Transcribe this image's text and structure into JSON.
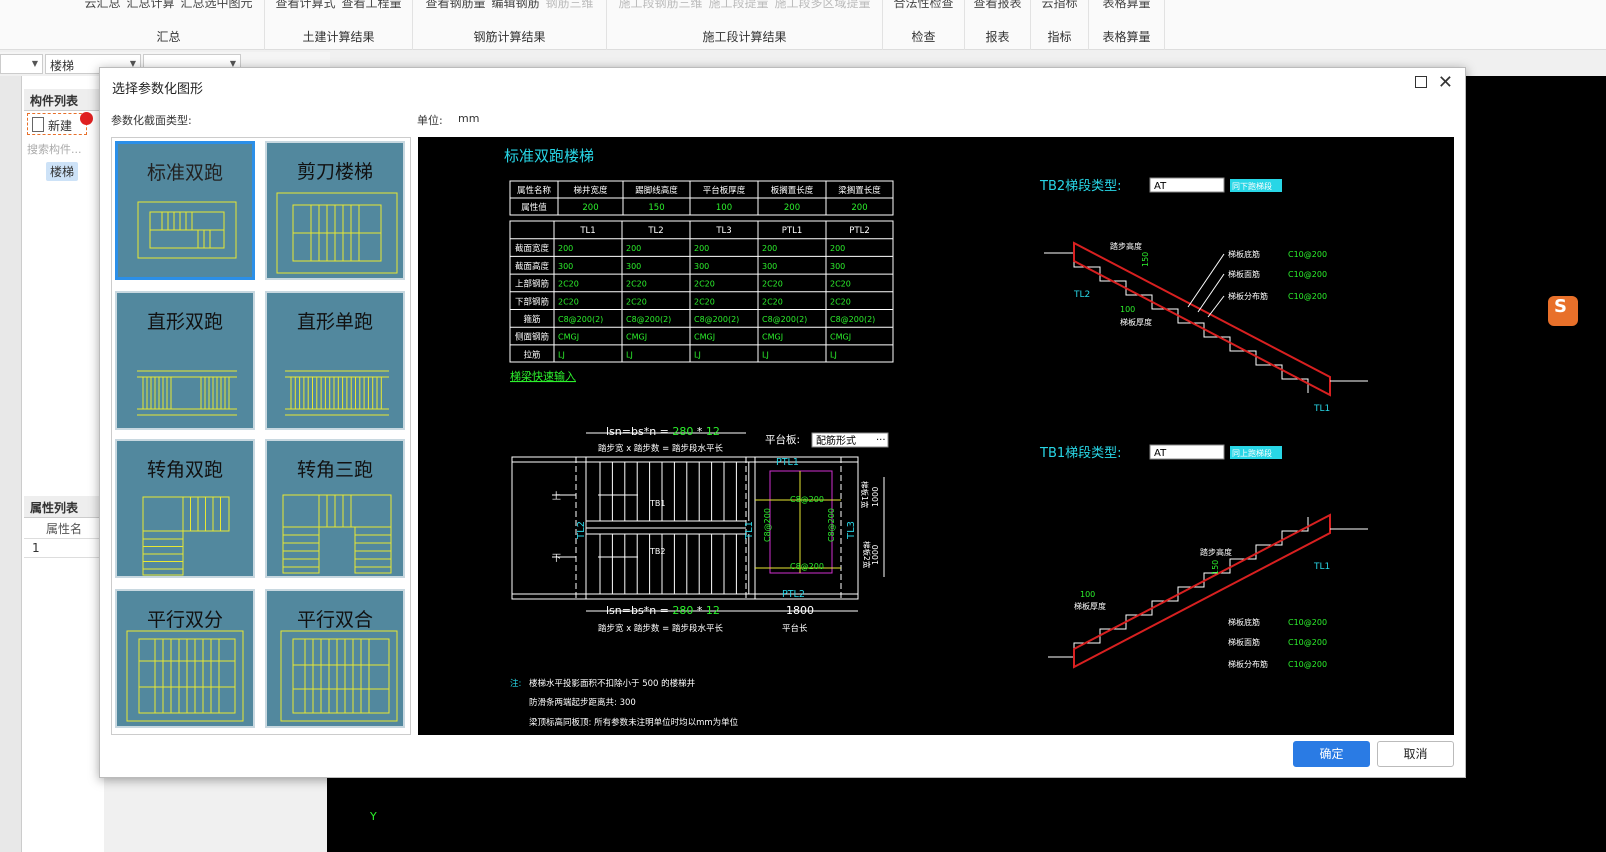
{
  "ribbon": {
    "groups": [
      {
        "name": "汇总",
        "items": [
          "云汇总",
          "汇总计算",
          "汇总选中图元"
        ],
        "disabled": []
      },
      {
        "name": "土建计算结果",
        "items": [
          "查看计算式",
          "查看工程量"
        ],
        "disabled": []
      },
      {
        "name": "钢筋计算结果",
        "items": [
          "查看钢筋量",
          "编辑钢筋",
          "钢筋三维"
        ],
        "disabled": [
          2
        ]
      },
      {
        "name": "施工段计算结果",
        "items": [
          "施工段钢筋三维",
          "施工段提量",
          "施工段多区域提量"
        ],
        "disabled": [
          0,
          1,
          2
        ]
      },
      {
        "name": "检查",
        "items": [
          "合法性检查"
        ],
        "disabled": []
      },
      {
        "name": "报表",
        "items": [
          "查看报表"
        ],
        "disabled": []
      },
      {
        "name": "指标",
        "items": [
          "云指标"
        ],
        "disabled": []
      },
      {
        "name": "表格算量",
        "items": [
          "表格算量"
        ],
        "disabled": []
      }
    ]
  },
  "left": {
    "combo1": "",
    "combo2": "楼梯",
    "combo3": "",
    "component_tab": "构件列表",
    "new_label": "新建",
    "search_placeholder": "搜索构件...",
    "item": "楼梯",
    "property_tab": "属性列表",
    "property_col": "属性名",
    "row1": "1"
  },
  "dialog": {
    "title": "选择参数化图形",
    "section_type_label": "参数化截面类型:",
    "unit_label": "单位:",
    "unit_value": "mm",
    "thumbs": [
      "标准双跑",
      "剪刀楼梯",
      "直形双跑",
      "直形单跑",
      "转角双跑",
      "转角三跑",
      "平行双分",
      "平行双合"
    ],
    "ok": "确定",
    "cancel": "取消"
  },
  "preview": {
    "title": "标准双跑楼梯",
    "attr_table": {
      "headers": [
        "属性名称",
        "梯井宽度",
        "踢脚线高度",
        "平台板厚度",
        "板搁置长度",
        "梁搁置长度"
      ],
      "row_label": "属性值",
      "values": [
        "200",
        "150",
        "100",
        "200",
        "200"
      ]
    },
    "beam_table": {
      "cols": [
        "TL1",
        "TL2",
        "TL3",
        "PTL1",
        "PTL2"
      ],
      "rows": [
        {
          "label": "截面宽度",
          "vals": [
            "200",
            "200",
            "200",
            "200",
            "200"
          ]
        },
        {
          "label": "截面高度",
          "vals": [
            "300",
            "300",
            "300",
            "300",
            "300"
          ]
        },
        {
          "label": "上部钢筋",
          "vals": [
            "2C20",
            "2C20",
            "2C20",
            "2C20",
            "2C20"
          ]
        },
        {
          "label": "下部钢筋",
          "vals": [
            "2C20",
            "2C20",
            "2C20",
            "2C20",
            "2C20"
          ]
        },
        {
          "label": "箍筋",
          "vals": [
            "C8@200(2)",
            "C8@200(2)",
            "C8@200(2)",
            "C8@200(2)",
            "C8@200(2)"
          ]
        },
        {
          "label": "侧面钢筋",
          "vals": [
            "CMGJ",
            "CMGJ",
            "CMGJ",
            "CMGJ",
            "CMGJ"
          ]
        },
        {
          "label": "拉筋",
          "vals": [
            "LJ",
            "LJ",
            "LJ",
            "LJ",
            "LJ"
          ]
        }
      ]
    },
    "quick_input": "梯梁快速输入",
    "formula_top": "lsn=bs*n = 280 * 12",
    "formula_prefix": "lsn=bs*n = ",
    "formula_280": "280",
    "formula_star": " * ",
    "formula_12": "12",
    "formula_sub": "踏步宽 x 踏步数 = 踏步段水平长",
    "platform_label": "平台板:",
    "platform_value": "配筋形式",
    "ptl1": "PTL1",
    "ptl2": "PTL2",
    "tl1": "TL1",
    "tl2": "TL2",
    "tl3": "TL3",
    "tb1": "TB1",
    "tb2": "TB2",
    "up": "上",
    "down": "下",
    "c8_200": "C8@200",
    "dim_1000": "1000",
    "dim_1800": "1800",
    "flight1_width": "梯板1宽",
    "flight2_width": "梯板2宽",
    "platform_len": "平台长",
    "tb2_type_label": "TB2梯段类型:",
    "tb2_type": "AT",
    "tb2_same": "同下跑梯段",
    "tb1_type_label": "TB1梯段类型:",
    "tb1_type": "AT",
    "tb1_same": "同上跑梯段",
    "step_height": "踏步高度",
    "slab_bottom": "梯板底筋",
    "slab_top": "梯板面筋",
    "slab_dist": "梯板分布筋",
    "c10_200": "C10@200",
    "slab_thick": "梯板厚度",
    "d150": "150",
    "d100": "100",
    "note1_prefix": "注:",
    "note1": "楼梯水平投影面积不扣除小于 500  的楼梯井",
    "note2": "防滑条两端起步距离共: 300",
    "note3": "梁顶标高同板顶: 所有参数未注明单位时均以mm为单位"
  },
  "cad": {
    "axis_label": "Y",
    "ime_logo": "S"
  }
}
